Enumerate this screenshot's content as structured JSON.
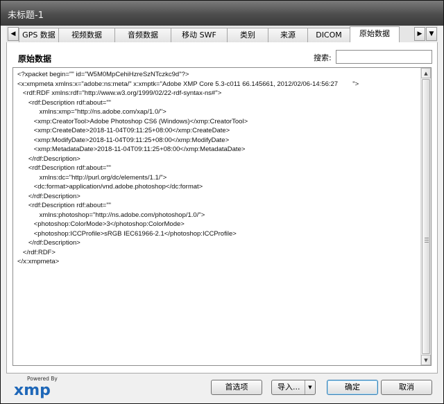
{
  "window": {
    "title": "未标题-1"
  },
  "tabs": {
    "items": [
      {
        "label": "GPS 数据",
        "active": false
      },
      {
        "label": "视频数据",
        "active": false
      },
      {
        "label": "音频数据",
        "active": false
      },
      {
        "label": "移动 SWF",
        "active": false
      },
      {
        "label": "类别",
        "active": false
      },
      {
        "label": "来源",
        "active": false
      },
      {
        "label": "DICOM",
        "active": false
      },
      {
        "label": "原始数据",
        "active": true
      }
    ],
    "left_arrow": "◀",
    "right_arrow": "▶"
  },
  "panel": {
    "title": "原始数据",
    "search_label": "搜索:",
    "search_value": ""
  },
  "xml": {
    "lines": [
      "<?xpacket begin=\"\" id=\"W5M0MpCehiHzreSzNTczkc9d\"?>",
      "<x:xmpmeta xmlns:x=\"adobe:ns:meta/\" x:xmptk=\"Adobe XMP Core 5.3-c011 66.145661, 2012/02/06-14:56:27        \">",
      "   <rdf:RDF xmlns:rdf=\"http://www.w3.org/1999/02/22-rdf-syntax-ns#\">",
      "      <rdf:Description rdf:about=\"\"",
      "            xmlns:xmp=\"http://ns.adobe.com/xap/1.0/\">",
      "         <xmp:CreatorTool>Adobe Photoshop CS6 (Windows)</xmp:CreatorTool>",
      "         <xmp:CreateDate>2018-11-04T09:11:25+08:00</xmp:CreateDate>",
      "         <xmp:ModifyDate>2018-11-04T09:11:25+08:00</xmp:ModifyDate>",
      "         <xmp:MetadataDate>2018-11-04T09:11:25+08:00</xmp:MetadataDate>",
      "      </rdf:Description>",
      "      <rdf:Description rdf:about=\"\"",
      "            xmlns:dc=\"http://purl.org/dc/elements/1.1/\">",
      "         <dc:format>application/vnd.adobe.photoshop</dc:format>",
      "      </rdf:Description>",
      "      <rdf:Description rdf:about=\"\"",
      "            xmlns:photoshop=\"http://ns.adobe.com/photoshop/1.0/\">",
      "         <photoshop:ColorMode>3</photoshop:ColorMode>",
      "         <photoshop:ICCProfile>sRGB IEC61966-2.1</photoshop:ICCProfile>",
      "      </rdf:Description>",
      "   </rdf:RDF>",
      "</x:xmpmeta>"
    ]
  },
  "footer": {
    "logo_powered": "Powered By",
    "logo_text": "xmp",
    "preferences_button": "首选项",
    "import_button": "导入...",
    "ok_button": "确定",
    "cancel_button": "取消"
  },
  "colors": {
    "logo_blue": "#1e67b8",
    "default_button_border": "#3c7fb1"
  }
}
